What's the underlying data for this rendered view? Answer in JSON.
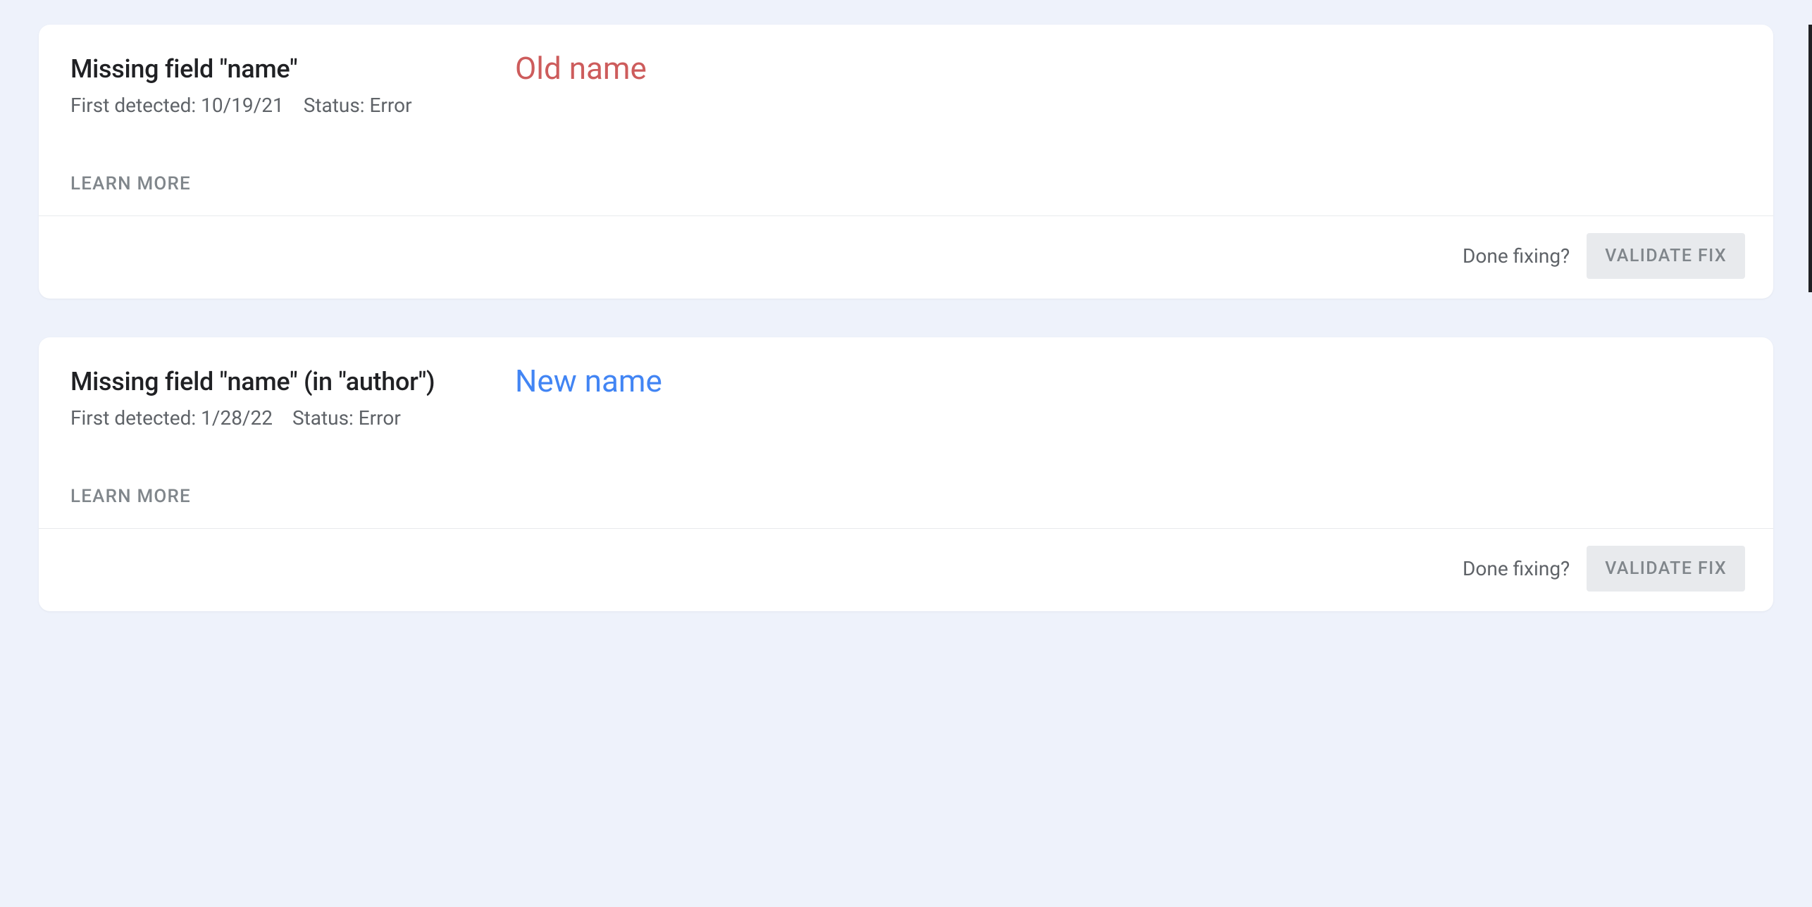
{
  "cards": [
    {
      "title": "Missing field \"name\"",
      "annotation_label": "Old name",
      "annotation_type": "old",
      "first_detected_label": "First detected:",
      "first_detected_value": "10/19/21",
      "status_label": "Status:",
      "status_value": "Error",
      "learn_more_label": "LEARN MORE",
      "done_fixing_label": "Done fixing?",
      "validate_label": "VALIDATE FIX"
    },
    {
      "title": "Missing field \"name\" (in \"author\")",
      "annotation_label": "New name",
      "annotation_type": "new",
      "first_detected_label": "First detected:",
      "first_detected_value": "1/28/22",
      "status_label": "Status:",
      "status_value": "Error",
      "learn_more_label": "LEARN MORE",
      "done_fixing_label": "Done fixing?",
      "validate_label": "VALIDATE FIX"
    }
  ]
}
